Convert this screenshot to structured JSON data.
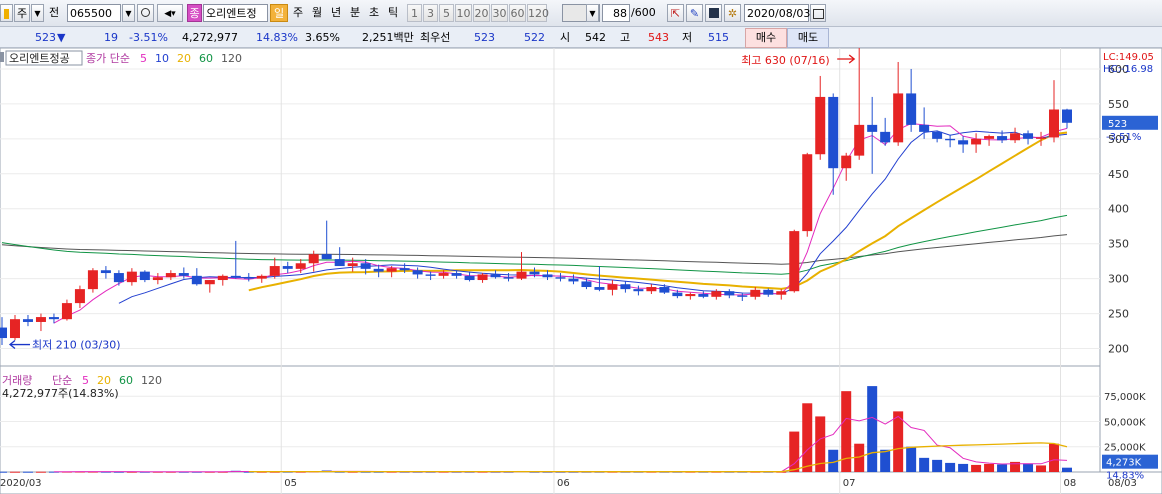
{
  "toolbar": {
    "btn_stock": "주",
    "btn_prev": "전",
    "code": "065500",
    "stock_name": "오리엔트정",
    "badge": "종",
    "periods": [
      "일",
      "주",
      "월",
      "년",
      "분",
      "초",
      "틱"
    ],
    "active_period": "일",
    "intervals": [
      "1",
      "3",
      "5",
      "10",
      "20",
      "30",
      "60",
      "120"
    ],
    "count": "88",
    "count_total": "/600",
    "date": "2020/08/03"
  },
  "quote": {
    "price": "523",
    "dir": "▼",
    "change": "19",
    "change_pct": "-3.51%",
    "volume": "4,272,977",
    "turnover": "14.83%",
    "ratio": "3.65%",
    "amount": "2,251백만",
    "best_label": "최우선",
    "best_ask": "523",
    "best_bid": "522",
    "open_label": "시",
    "open": "542",
    "high_label": "고",
    "high": "543",
    "low_label": "저",
    "low": "515",
    "buy": "매수",
    "sell": "매도"
  },
  "chart_data": [
    {
      "type": "candlestick",
      "name": "오리엔트정공",
      "legend_prefix": "종가 단순",
      "ma_periods": [
        "5",
        "10",
        "20",
        "60",
        "120"
      ],
      "ma_colors": [
        "#e32bbf",
        "#2340d0",
        "#e8b100",
        "#119445",
        "#555555"
      ],
      "candle_up": "#e62424",
      "candle_down": "#1f4fd1",
      "y_ticks": [
        200,
        250,
        300,
        350,
        400,
        450,
        500,
        550,
        600
      ],
      "ylim": [
        175,
        630
      ],
      "x_labels": [
        "2020/03",
        "05",
        "06",
        "07",
        "08",
        "08/03"
      ],
      "lc_label": "LC:149.05",
      "hc_label": "HC:-16.98",
      "last_price_tag": "523",
      "last_pct_tag": "-3.51%",
      "annot_high": "최고 630 (07/16)",
      "annot_low": "최저 210 (03/30)",
      "ohlc": [
        [
          230,
          245,
          205,
          215
        ],
        [
          215,
          248,
          212,
          242
        ],
        [
          242,
          248,
          232,
          238
        ],
        [
          238,
          250,
          225,
          245
        ],
        [
          245,
          250,
          236,
          242
        ],
        [
          242,
          270,
          240,
          265
        ],
        [
          265,
          290,
          258,
          285
        ],
        [
          285,
          315,
          280,
          312
        ],
        [
          312,
          318,
          300,
          308
        ],
        [
          308,
          312,
          290,
          295
        ],
        [
          295,
          315,
          290,
          310
        ],
        [
          310,
          312,
          295,
          298
        ],
        [
          298,
          308,
          292,
          302
        ],
        [
          302,
          312,
          298,
          308
        ],
        [
          308,
          316,
          300,
          304
        ],
        [
          304,
          315,
          290,
          292
        ],
        [
          292,
          298,
          280,
          298
        ],
        [
          298,
          306,
          290,
          304
        ],
        [
          304,
          354,
          300,
          302
        ],
        [
          302,
          308,
          296,
          300
        ],
        [
          300,
          306,
          294,
          304
        ],
        [
          304,
          330,
          300,
          318
        ],
        [
          318,
          324,
          308,
          314
        ],
        [
          314,
          328,
          308,
          322
        ],
        [
          322,
          340,
          310,
          335
        ],
        [
          335,
          383,
          328,
          328
        ],
        [
          328,
          345,
          322,
          318
        ],
        [
          318,
          330,
          310,
          322
        ],
        [
          322,
          328,
          306,
          314
        ],
        [
          314,
          320,
          302,
          310
        ],
        [
          310,
          318,
          302,
          315
        ],
        [
          315,
          322,
          308,
          312
        ],
        [
          312,
          316,
          300,
          306
        ],
        [
          306,
          310,
          298,
          304
        ],
        [
          304,
          312,
          300,
          308
        ],
        [
          308,
          312,
          300,
          304
        ],
        [
          304,
          310,
          296,
          298
        ],
        [
          298,
          308,
          294,
          306
        ],
        [
          306,
          312,
          300,
          302
        ],
        [
          302,
          308,
          296,
          300
        ],
        [
          300,
          338,
          298,
          310
        ],
        [
          310,
          316,
          302,
          306
        ],
        [
          306,
          312,
          298,
          302
        ],
        [
          302,
          308,
          296,
          300
        ],
        [
          300,
          306,
          292,
          296
        ],
        [
          296,
          300,
          285,
          288
        ],
        [
          288,
          318,
          282,
          284
        ],
        [
          284,
          298,
          276,
          292
        ],
        [
          292,
          296,
          280,
          285
        ],
        [
          285,
          290,
          276,
          282
        ],
        [
          282,
          292,
          278,
          288
        ],
        [
          288,
          292,
          278,
          280
        ],
        [
          280,
          284,
          272,
          275
        ],
        [
          275,
          280,
          270,
          278
        ],
        [
          278,
          282,
          272,
          274
        ],
        [
          274,
          285,
          270,
          282
        ],
        [
          282,
          285,
          272,
          276
        ],
        [
          276,
          280,
          268,
          274
        ],
        [
          274,
          288,
          270,
          284
        ],
        [
          284,
          286,
          274,
          277
        ],
        [
          277,
          285,
          270,
          282
        ],
        [
          282,
          370,
          280,
          368
        ],
        [
          368,
          480,
          360,
          478
        ],
        [
          478,
          590,
          470,
          560
        ],
        [
          560,
          565,
          420,
          458
        ],
        [
          458,
          480,
          440,
          476
        ],
        [
          476,
          630,
          470,
          520
        ],
        [
          520,
          560,
          450,
          510
        ],
        [
          510,
          530,
          490,
          495
        ],
        [
          495,
          610,
          490,
          565
        ],
        [
          565,
          600,
          510,
          520
        ],
        [
          520,
          545,
          500,
          510
        ],
        [
          510,
          512,
          495,
          500
        ],
        [
          500,
          506,
          488,
          498
        ],
        [
          498,
          504,
          480,
          492
        ],
        [
          492,
          508,
          480,
          500
        ],
        [
          500,
          506,
          490,
          504
        ],
        [
          504,
          512,
          494,
          498
        ],
        [
          498,
          516,
          494,
          508
        ],
        [
          508,
          512,
          492,
          500
        ],
        [
          500,
          510,
          490,
          502
        ],
        [
          502,
          584,
          495,
          542
        ],
        [
          542,
          543,
          515,
          523
        ]
      ],
      "volume_ticks": [
        "75,000K",
        "50,000K",
        "25,000K"
      ],
      "volume_legend": "거래량",
      "volume_info": "4,272,977주(14.83%)",
      "volume_last_tag": "4,273K",
      "volume_pct_tag": "14.83%",
      "volume_k": [
        300,
        300,
        300,
        300,
        350,
        400,
        450,
        400,
        350,
        300,
        300,
        300,
        300,
        300,
        300,
        300,
        300,
        300,
        1200,
        350,
        300,
        300,
        350,
        300,
        650,
        1500,
        320,
        300,
        300,
        300,
        300,
        300,
        300,
        300,
        300,
        300,
        300,
        300,
        300,
        300,
        1000,
        300,
        300,
        300,
        300,
        300,
        300,
        300,
        300,
        300,
        300,
        300,
        300,
        300,
        300,
        300,
        300,
        300,
        300,
        300,
        300,
        40000,
        68000,
        55000,
        22000,
        80000,
        28000,
        85000,
        22000,
        60000,
        25000,
        14000,
        12000,
        9000,
        8000,
        7000,
        8000,
        7500,
        10000,
        8500,
        6500,
        28000,
        4273
      ]
    }
  ]
}
